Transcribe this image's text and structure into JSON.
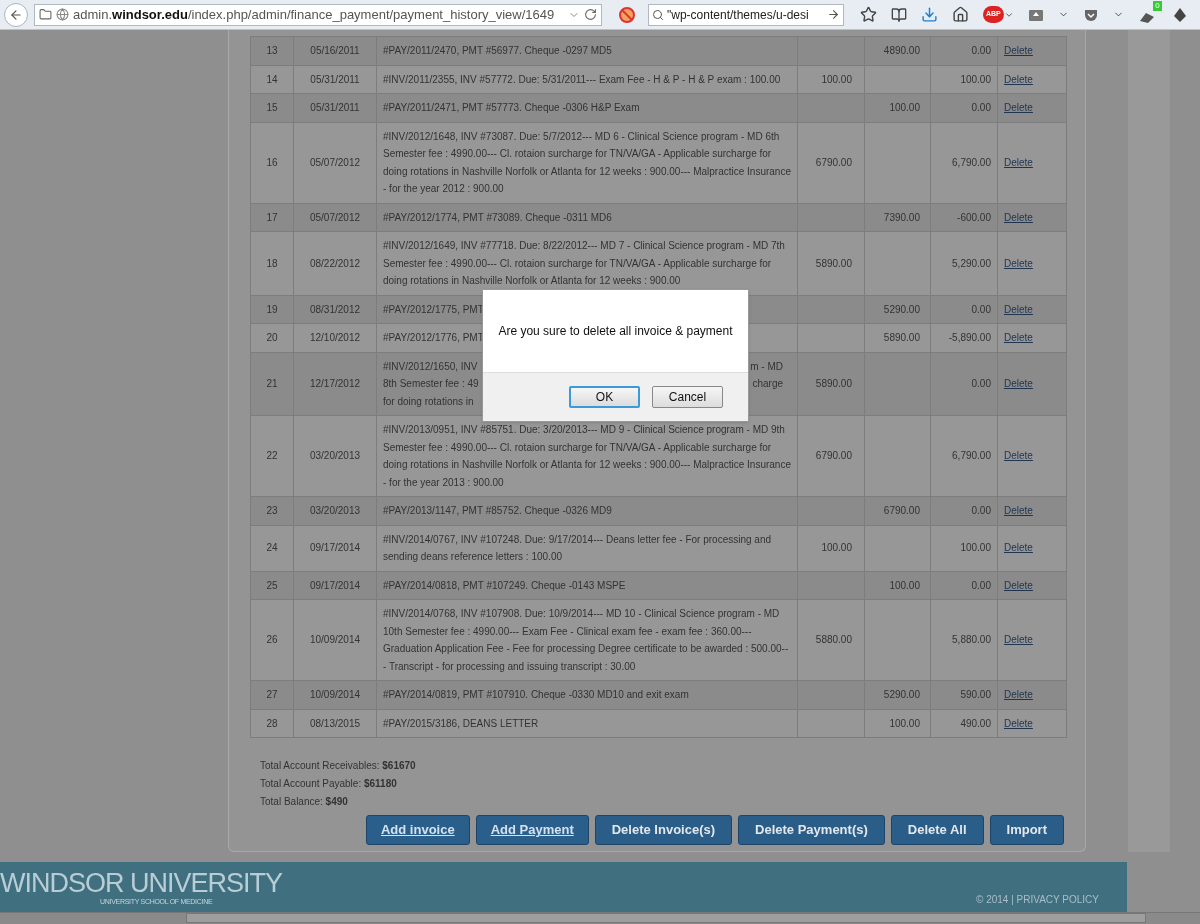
{
  "browser": {
    "url": "admin.**windsor.edu**/index.php/admin/finance_payment/payment_history_view/1649",
    "search": {
      "value": "\"wp-content/themes/u-desi"
    },
    "adblock_label": "ABP",
    "notification_count": "0"
  },
  "table": {
    "rows": [
      {
        "kind": "full",
        "number": "13",
        "date": "05/16/2011",
        "description": "#PAY/2011/2470, PMT #56977. Cheque -0297 MD5",
        "credit": "4890.00",
        "balance": "0.00",
        "action": "Delete"
      },
      {
        "kind": "full",
        "number": "14",
        "date": "05/31/2011",
        "description": "#INV/2011/2355, INV #57772. Due: 5/31/2011--- Exam Fee - H & P - H & P exam : 100.00",
        "debit": "100.00",
        "balance": "100.00",
        "action": "Delete"
      },
      {
        "kind": "full",
        "number": "15",
        "date": "05/31/2011",
        "description": "#PAY/2011/2471, PMT #57773. Cheque -0306 H&P Exam",
        "credit": "100.00",
        "balance": "0.00",
        "action": "Delete"
      },
      {
        "kind": "full",
        "number": "16",
        "date": "05/07/2012",
        "description": "#INV/2012/1648, INV #73087. Due: 5/7/2012--- MD 6 - Clinical Science program - MD 6th Semester fee : 4990.00--- Cl. rotaion surcharge for TN/VA/GA - Applicable surcharge for doing rotations in Nashville Norfolk or Atlanta for 12 weeks : 900.00--- Malpractice Insurance - for the year 2012 : 900.00",
        "debit": "6790.00",
        "balance": "6,790.00",
        "action": "Delete"
      },
      {
        "kind": "full",
        "number": "17",
        "date": "05/07/2012",
        "description": "#PAY/2012/1774, PMT #73089. Cheque -0311 MD6",
        "credit": "7390.00",
        "balance": "-600.00",
        "action": "Delete"
      },
      {
        "kind": "full",
        "number": "18",
        "date": "08/22/2012",
        "description": "#INV/2012/1649, INV #77718. Due: 8/22/2012--- MD 7 - Clinical Science program - MD 7th Semester fee : 4990.00--- Cl. rotaion surcharge for TN/VA/GA - Applicable surcharge for doing rotations in Nashville Norfolk or Atlanta for 12 weeks : 900.00",
        "debit": "5890.00",
        "balance": "5,290.00",
        "action": "Delete"
      },
      {
        "kind": "covered",
        "number": "19",
        "date": "08/31/2012",
        "description_left": [
          "#PAY/2012/1775, PMT"
        ],
        "credit": "5290.00",
        "balance": "0.00",
        "action": "Delete"
      },
      {
        "kind": "covered",
        "number": "20",
        "date": "12/10/2012",
        "description_left": [
          "#PAY/2012/1776, PMT"
        ],
        "credit": "5890.00",
        "balance": "-5,890.00",
        "action": "Delete"
      },
      {
        "kind": "covered",
        "number": "21",
        "date": "12/17/2012",
        "description_left": [
          "#INV/2012/1650, INV",
          "8th Semester fee : 49",
          "for doing rotations in"
        ],
        "description_right": [
          "m - MD",
          "charge"
        ],
        "debit": "5890.00",
        "balance": "0.00",
        "action": "Delete"
      },
      {
        "kind": "full",
        "number": "22",
        "date": "03/20/2013",
        "description": "#INV/2013/0951, INV #85751. Due: 3/20/2013--- MD 9 - Clinical Science program - MD 9th Semester fee : 4990.00--- Cl. rotaion surcharge for TN/VA/GA - Applicable surcharge for doing rotations in Nashville Norfolk or Atlanta for 12 weeks : 900.00--- Malpractice Insurance - for the year 2013 : 900.00",
        "debit": "6790.00",
        "balance": "6,790.00",
        "action": "Delete"
      },
      {
        "kind": "full",
        "number": "23",
        "date": "03/20/2013",
        "description": "#PAY/2013/1147, PMT #85752. Cheque -0326 MD9",
        "credit": "6790.00",
        "balance": "0.00",
        "action": "Delete"
      },
      {
        "kind": "full",
        "number": "24",
        "date": "09/17/2014",
        "description": "#INV/2014/0767, INV #107248. Due: 9/17/2014--- Deans letter fee - For processing and sending deans reference letters : 100.00",
        "debit": "100.00",
        "balance": "100.00",
        "action": "Delete"
      },
      {
        "kind": "full",
        "number": "25",
        "date": "09/17/2014",
        "description": "#PAY/2014/0818, PMT #107249. Cheque -0143 MSPE",
        "credit": "100.00",
        "balance": "0.00",
        "action": "Delete"
      },
      {
        "kind": "full",
        "number": "26",
        "date": "10/09/2014",
        "description": "#INV/2014/0768, INV #107908. Due: 10/9/2014--- MD 10 - Clinical Science program - MD 10th Semester fee : 4990.00--- Exam Fee - Clinical exam fee - exam fee : 360.00--- Graduation Application Fee - Fee for processing Degree certificate to be awarded : 500.00--- Transcript - for processing and issuing transcript : 30.00",
        "debit": "5880.00",
        "balance": "5,880.00",
        "action": "Delete"
      },
      {
        "kind": "full",
        "number": "27",
        "date": "10/09/2014",
        "description": "#PAY/2014/0819, PMT #107910. Cheque -0330 MD10 and exit exam",
        "credit": "5290.00",
        "balance": "590.00",
        "action": "Delete"
      },
      {
        "kind": "full",
        "number": "28",
        "date": "08/13/2015",
        "description": "#PAY/2015/3186, DEANS LETTER",
        "credit": "100.00",
        "balance": "490.00",
        "action": "Delete"
      }
    ]
  },
  "totals": [
    {
      "label": "Total Account Receivables:",
      "value": "$61670"
    },
    {
      "label": "Total Account Payable:",
      "value": "$61180"
    },
    {
      "label": "Total Balance:",
      "value": "$490"
    }
  ],
  "actions": [
    {
      "label": "Add invoice",
      "kind": "link"
    },
    {
      "label": "Add Payment",
      "kind": "link"
    },
    {
      "label": "Delete Invoice(s)",
      "kind": "button"
    },
    {
      "label": "Delete Payment(s)",
      "kind": "button"
    },
    {
      "label": "Delete All",
      "kind": "button"
    },
    {
      "label": "Import",
      "kind": "button"
    }
  ],
  "dialog": {
    "message": "Are you sure to delete all invoice & payment",
    "buttons": [
      {
        "label": "OK",
        "focused": true
      },
      {
        "label": "Cancel",
        "focused": false
      }
    ]
  },
  "footer": {
    "title": "WINDSOR UNIVERSITY",
    "subtitle": "UNIVERSITY SCHOOL OF MEDICINE",
    "copyright": "© 2014 | PRIVACY POLICY"
  }
}
